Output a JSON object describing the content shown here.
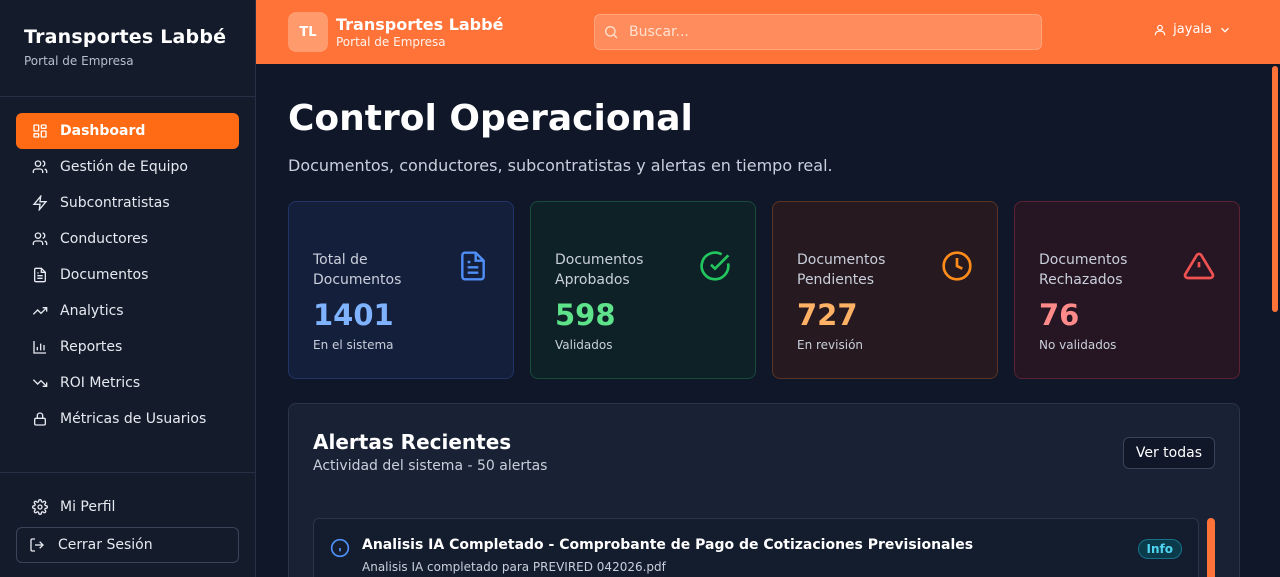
{
  "colors": {
    "accent": "#ff6a14",
    "topbar": "#ff7338",
    "bg": "#0f1729",
    "blue": "#7fb3ff",
    "green": "#5ee28a",
    "orange": "#ffb266",
    "red": "#ff8a8a"
  },
  "sidebar": {
    "brand_title": "Transportes Labbé",
    "brand_subtitle": "Portal de Empresa",
    "items": [
      {
        "label": "Dashboard",
        "icon": "dashboard-icon",
        "active": true
      },
      {
        "label": "Gestión de Equipo",
        "icon": "team-icon"
      },
      {
        "label": "Subcontratistas",
        "icon": "lightning-icon"
      },
      {
        "label": "Conductores",
        "icon": "users-icon"
      },
      {
        "label": "Documentos",
        "icon": "document-icon"
      },
      {
        "label": "Analytics",
        "icon": "trending-up-icon"
      },
      {
        "label": "Reportes",
        "icon": "bar-chart-icon"
      },
      {
        "label": "ROI Metrics",
        "icon": "trending-down-icon"
      },
      {
        "label": "Métricas de Usuarios",
        "icon": "lock-icon"
      }
    ],
    "profile_label": "Mi Perfil",
    "logout_label": "Cerrar Sesión"
  },
  "topbar": {
    "logo_initials": "TL",
    "title": "Transportes Labbé",
    "subtitle": "Portal de Empresa",
    "search_placeholder": "Buscar...",
    "username": "jayala"
  },
  "main": {
    "title": "Control Operacional",
    "subtitle": "Documentos, conductores, subcontratistas y alertas en tiempo real.",
    "stats": [
      {
        "label": "Total de Documentos",
        "value": "1401",
        "note": "En el sistema",
        "icon": "document-icon"
      },
      {
        "label": "Documentos Aprobados",
        "value": "598",
        "note": "Validados",
        "icon": "check-circle-icon"
      },
      {
        "label": "Documentos Pendientes",
        "value": "727",
        "note": "En revisión",
        "icon": "clock-icon"
      },
      {
        "label": "Documentos Rechazados",
        "value": "76",
        "note": "No validados",
        "icon": "warning-icon"
      }
    ],
    "alerts": {
      "title": "Alertas Recientes",
      "subtitle": "Actividad del sistema - 50 alertas",
      "view_all_label": "Ver todas",
      "items": [
        {
          "title": "Analisis IA Completado - Comprobante de Pago de Cotizaciones Previsionales",
          "description": "Analisis IA completado para PREVIRED 042026.pdf",
          "badge": "Info",
          "icon": "info-icon"
        }
      ]
    }
  }
}
